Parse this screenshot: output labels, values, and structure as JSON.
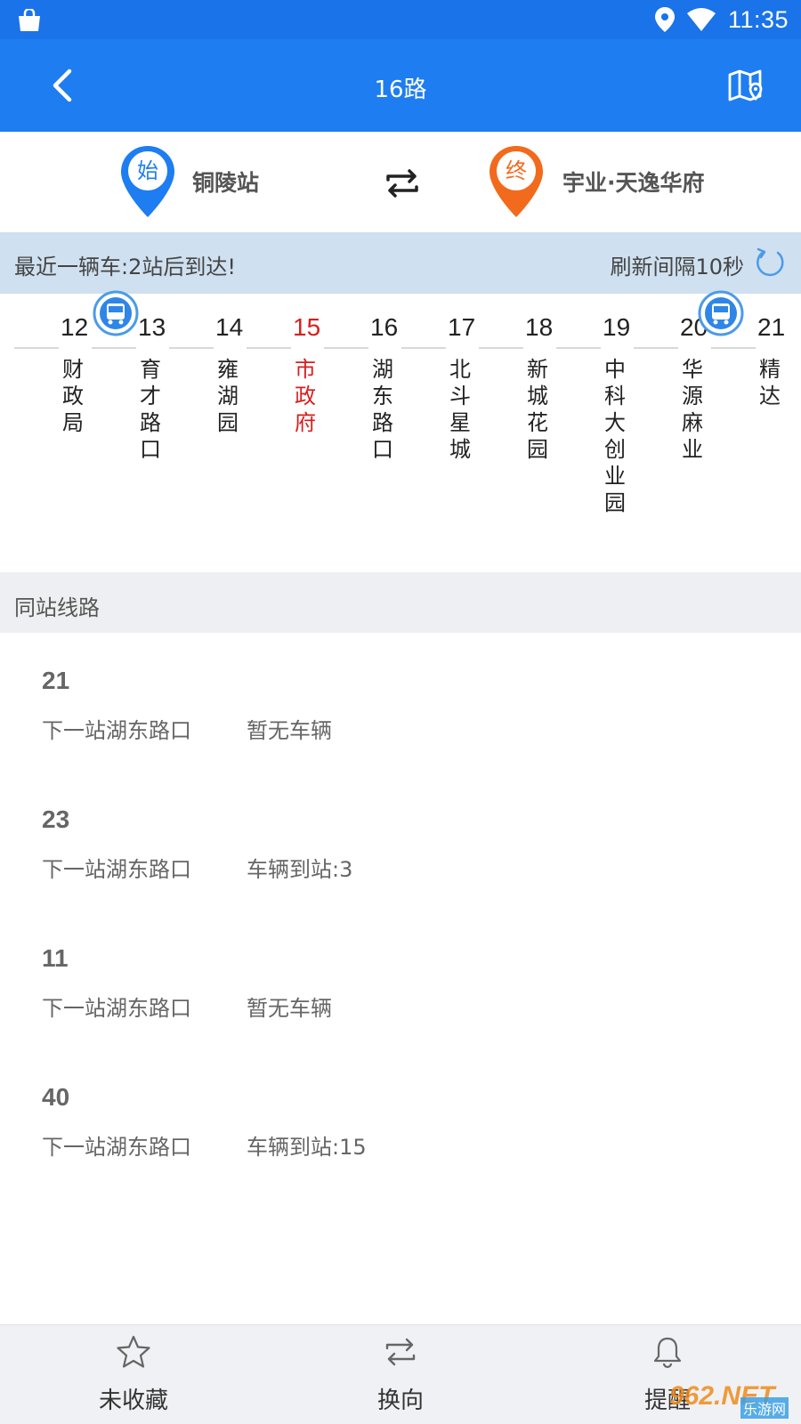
{
  "status_bar": {
    "time": "11:35"
  },
  "header": {
    "title": "16路"
  },
  "endpoints": {
    "start_badge": "始",
    "start_name": "铜陵站",
    "end_badge": "终",
    "end_name": "宇业·天逸华府",
    "start_color": "#1e7df0",
    "end_color": "#f26a1c"
  },
  "info": {
    "message": "最近一辆车:2站后到达!",
    "refresh": "刷新间隔10秒"
  },
  "stations": [
    {
      "num": "12",
      "name": "财政局"
    },
    {
      "num": "13",
      "name": "育才路口"
    },
    {
      "num": "14",
      "name": "雍湖园"
    },
    {
      "num": "15",
      "name": "市政府",
      "current": true
    },
    {
      "num": "16",
      "name": "湖东路口"
    },
    {
      "num": "17",
      "name": "北斗星城"
    },
    {
      "num": "18",
      "name": "新城花园"
    },
    {
      "num": "19",
      "name": "中科大创业园"
    },
    {
      "num": "20",
      "name": "华源麻业"
    },
    {
      "num": "21",
      "name": "精达"
    }
  ],
  "section_title": "同站线路",
  "routes": [
    {
      "num": "21",
      "next": "下一站湖东路口",
      "status": "暂无车辆"
    },
    {
      "num": "23",
      "next": "下一站湖东路口",
      "status": "车辆到站:3"
    },
    {
      "num": "11",
      "next": "下一站湖东路口",
      "status": "暂无车辆"
    },
    {
      "num": "40",
      "next": "下一站湖东路口",
      "status": "车辆到站:15"
    }
  ],
  "tabs": [
    {
      "label": "未收藏",
      "icon": "star-icon"
    },
    {
      "label": "换向",
      "icon": "swap-icon"
    },
    {
      "label": "提醒",
      "icon": "bell-icon"
    }
  ],
  "watermark": {
    "brand": "962.NET",
    "sub": "乐游网"
  },
  "colors": {
    "header": "#1e7df0",
    "current_station": "#d81e1e",
    "info_bar": "#cfe0f0"
  }
}
